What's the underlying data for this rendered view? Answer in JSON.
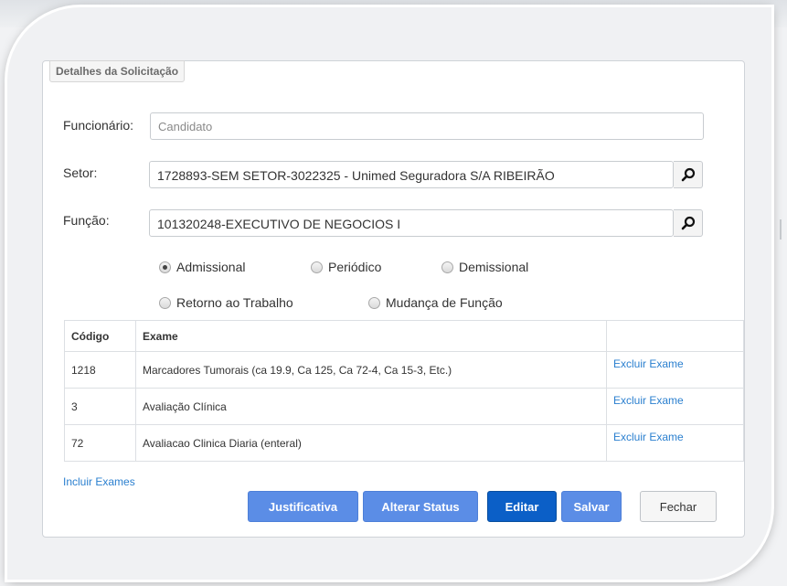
{
  "fieldset": {
    "legend": "Detalhes da Solicitação"
  },
  "form": {
    "funcionario": {
      "label": "Funcionário:",
      "placeholder": "Candidato"
    },
    "setor": {
      "label": "Setor:",
      "value": "1728893-SEM SETOR-3022325 - Unimed Seguradora S/A RIBEIRÃO"
    },
    "funcao": {
      "label": "Função:",
      "value": "101320248-EXECUTIVO DE NEGOCIOS I"
    }
  },
  "exam_types": [
    {
      "label": "Admissional",
      "checked": true
    },
    {
      "label": "Periódico",
      "checked": false
    },
    {
      "label": "Demissional",
      "checked": false
    },
    {
      "label": "Retorno ao Trabalho",
      "checked": false
    },
    {
      "label": "Mudança de Função",
      "checked": false
    }
  ],
  "table": {
    "headers": [
      "Código",
      "Exame",
      ""
    ],
    "rows": [
      {
        "codigo": "1218",
        "exame": "Marcadores Tumorais (ca 19.9, Ca 125, Ca 72-4, Ca 15-3, Etc.)",
        "action": "Excluir Exame"
      },
      {
        "codigo": "3",
        "exame": "Avaliação Clínica",
        "action": "Excluir Exame"
      },
      {
        "codigo": "72",
        "exame": "Avaliacao Clinica Diaria (enteral)",
        "action": "Excluir Exame"
      }
    ]
  },
  "links": {
    "incluir": "Incluir Exames"
  },
  "buttons": {
    "justificativa": "Justificativa",
    "alterar_status": "Alterar Status",
    "editar": "Editar",
    "salvar": "Salvar",
    "fechar": "Fechar"
  },
  "colors": {
    "link": "#2a7fcf",
    "button_light": "#5b8de6",
    "button_primary": "#0b5fc7"
  },
  "icons": {
    "search": "magnifier-icon"
  }
}
